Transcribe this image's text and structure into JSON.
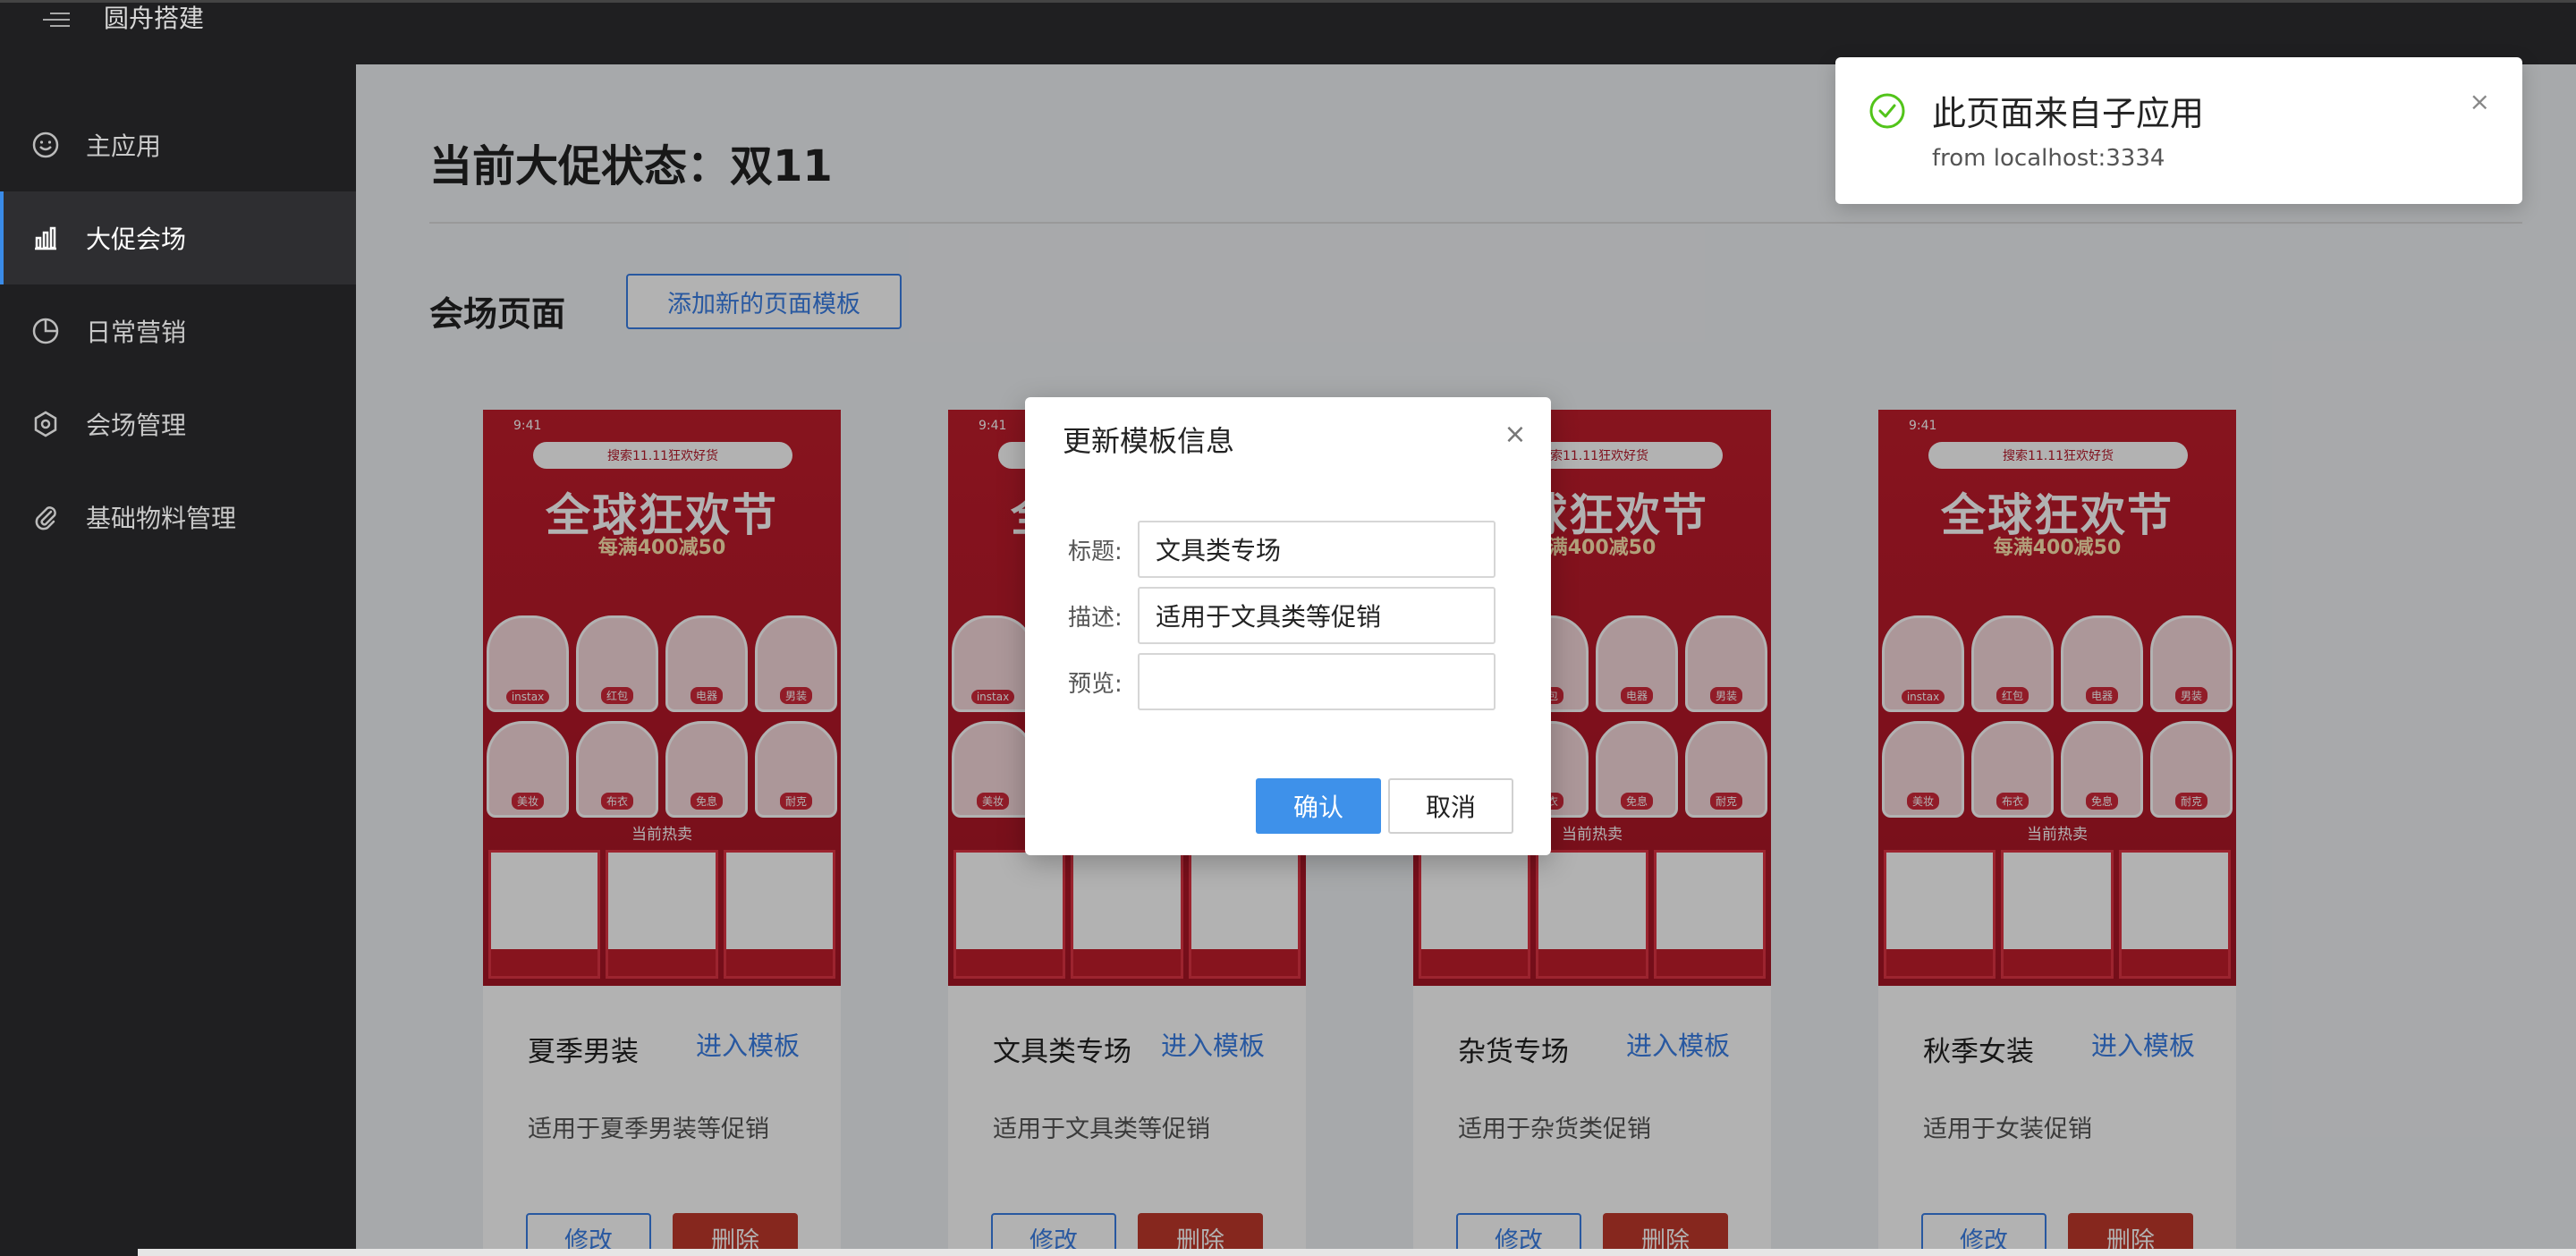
{
  "app": {
    "title": "圆舟搭建"
  },
  "sidebar": {
    "items": [
      {
        "label": "主应用",
        "icon": "smile-icon",
        "active": false
      },
      {
        "label": "大促会场",
        "icon": "bar-chart-icon",
        "active": true
      },
      {
        "label": "日常营销",
        "icon": "pie-chart-icon",
        "active": false
      },
      {
        "label": "会场管理",
        "icon": "hexagon-settings-icon",
        "active": false
      },
      {
        "label": "基础物料管理",
        "icon": "paperclip-icon",
        "active": false
      }
    ]
  },
  "main": {
    "page_title": "当前大促状态：双11",
    "section_title": "会场页面",
    "add_button": "添加新的页面模板",
    "cards": [
      {
        "name": "夏季男装",
        "link": "进入模板",
        "desc": "适用于夏季男装等促销",
        "edit": "修改",
        "delete": "删除"
      },
      {
        "name": "文具类专场",
        "link": "进入模板",
        "desc": "适用于文具类等促销",
        "edit": "修改",
        "delete": "删除"
      },
      {
        "name": "杂货专场",
        "link": "进入模板",
        "desc": "适用于杂货类促销",
        "edit": "修改",
        "delete": "删除"
      },
      {
        "name": "秋季女装",
        "link": "进入模板",
        "desc": "适用于女装促销",
        "edit": "修改",
        "delete": "删除"
      }
    ],
    "preview": {
      "time": "9:41",
      "search": "搜索11.11狂欢好货",
      "banner": "全球狂欢节",
      "banner_sub": "每满400减50",
      "hot": "当前热卖"
    }
  },
  "modal": {
    "title": "更新模板信息",
    "fields": [
      {
        "label": "标题:",
        "value": "文具类专场"
      },
      {
        "label": "描述:",
        "value": "适用于文具类等促销"
      },
      {
        "label": "预览:",
        "value": ""
      }
    ],
    "ok": "确认",
    "cancel": "取消"
  },
  "notification": {
    "title": "此页面来自子应用",
    "text": "from localhost:3334",
    "accent": "#52c41a"
  },
  "colors": {
    "primary": "#3a7ee6",
    "danger": "#c0392b",
    "sidebar_bg": "#1f1f21"
  }
}
